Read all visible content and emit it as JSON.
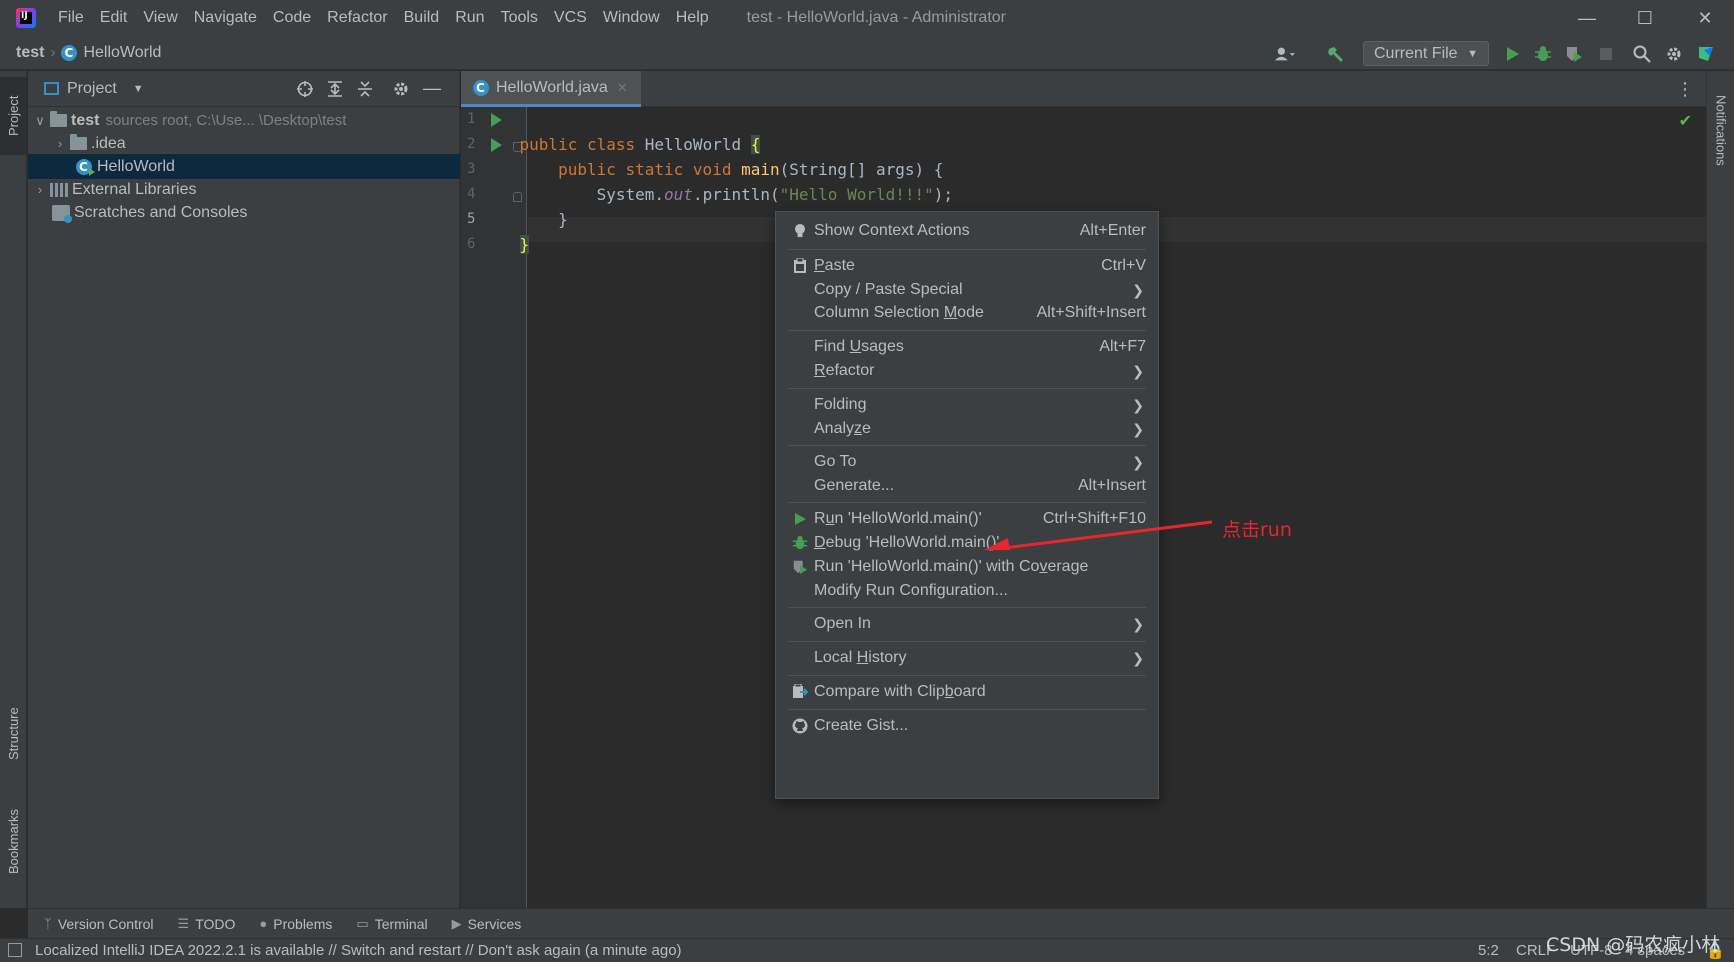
{
  "titlebar": {
    "menus": [
      "File",
      "Edit",
      "View",
      "Navigate",
      "Code",
      "Refactor",
      "Build",
      "Run",
      "Tools",
      "VCS",
      "Window",
      "Help"
    ],
    "window_title": "test - HelloWorld.java - Administrator"
  },
  "navbar": {
    "project": "test",
    "file": "HelloWorld",
    "run_config": "Current File"
  },
  "left_stripe": {
    "project": "Project",
    "structure": "Structure",
    "bookmarks": "Bookmarks"
  },
  "right_stripe": {
    "notifications": "Notifications"
  },
  "project_panel": {
    "title": "Project",
    "tree": [
      {
        "label": "test",
        "detail": "sources root,  C:\\Use...              \\Desktop\\test"
      },
      {
        "label": ".idea"
      },
      {
        "label": "HelloWorld"
      },
      {
        "label": "External Libraries"
      },
      {
        "label": "Scratches and Consoles"
      }
    ]
  },
  "editor": {
    "tab": "HelloWorld.java",
    "line_numbers": [
      "1",
      "2",
      "3",
      "4",
      "5",
      "6"
    ],
    "code": {
      "l1_kw": "public class ",
      "l1_name": "HelloWorld ",
      "l1_brace": "{",
      "l2_indent": "    ",
      "l2_kw": "public static void ",
      "l2_fn": "main",
      "l2_rest": "(String[] args) {",
      "l3_a": "        System.",
      "l3_field": "out",
      "l3_b": ".println(",
      "l3_str": "\"Hello World!!!\"",
      "l3_c": ");",
      "l4": "    }",
      "l5": "}"
    }
  },
  "context_menu": {
    "show_context_actions": {
      "label": "Show Context Actions",
      "shortcut": "Alt+Enter"
    },
    "paste": {
      "label_pre": "",
      "label_u": "P",
      "label_post": "aste",
      "shortcut": "Ctrl+V"
    },
    "copy_paste_special": {
      "label": "Copy / Paste Special"
    },
    "column_selection": {
      "label_pre": "Column Selection ",
      "label_u": "M",
      "label_post": "ode",
      "shortcut": "Alt+Shift+Insert"
    },
    "find_usages": {
      "label_pre": "Find ",
      "label_u": "U",
      "label_post": "sages",
      "shortcut": "Alt+F7"
    },
    "refactor": {
      "label_pre": "",
      "label_u": "R",
      "label_post": "efactor"
    },
    "folding": {
      "label": "Folding"
    },
    "analyze": {
      "label_pre": "Analy",
      "label_u": "z",
      "label_post": "e"
    },
    "go_to": {
      "label": "Go To"
    },
    "generate": {
      "label": "Generate...",
      "shortcut": "Alt+Insert"
    },
    "run": {
      "label_pre": "R",
      "label_u": "u",
      "label_post": "n 'HelloWorld.main()'",
      "shortcut": "Ctrl+Shift+F10"
    },
    "debug": {
      "label_pre": "",
      "label_u": "D",
      "label_post": "ebug 'HelloWorld.main()'"
    },
    "run_coverage": {
      "label_pre": "Run 'HelloWorld.main()' with Co",
      "label_u": "v",
      "label_post": "erage"
    },
    "modify_run_config": {
      "label": "Modify Run Configuration..."
    },
    "open_in": {
      "label": "Open In"
    },
    "local_history": {
      "label_pre": "Local ",
      "label_u": "H",
      "label_post": "istory"
    },
    "compare_clipboard": {
      "label_pre": "Compare with Clip",
      "label_u": "b",
      "label_post": "oard"
    },
    "create_gist": {
      "label": "Create Gist..."
    }
  },
  "annotation": {
    "text": "点击run",
    "color": "#e8262b"
  },
  "bottom_bar": {
    "tabs": [
      "Version Control",
      "TODO",
      "Problems",
      "Terminal",
      "Services"
    ]
  },
  "status_bar": {
    "message": "Localized IntelliJ IDEA 2022.2.1 is available // Switch and restart // Don't ask again (a minute ago)",
    "position": "5:2",
    "line_sep": "CRLF",
    "encoding": "UTF-8",
    "indent": "4 spaces"
  },
  "watermark": "CSDN @码农疯小林",
  "colors": {
    "accent": "#4a88c7",
    "run_green": "#499c54",
    "selection": "#0d293e"
  }
}
